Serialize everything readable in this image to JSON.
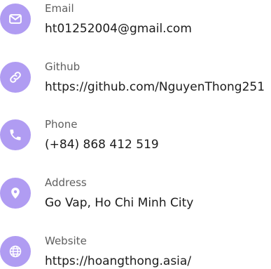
{
  "colors": {
    "icon_background": "#b09cf2",
    "icon_foreground": "#ffffff",
    "label_text": "#5f5f5f",
    "value_text": "#1c1c1c"
  },
  "contacts": [
    {
      "label": "Email",
      "value": "ht01252004@gmail.com",
      "icon": "mail-icon"
    },
    {
      "label": "Github",
      "value": "https://github.com/NguyenThong251",
      "icon": "link-icon"
    },
    {
      "label": "Phone",
      "value": "(+84) 868 412 519",
      "icon": "phone-icon"
    },
    {
      "label": "Address",
      "value": "Go Vap, Ho Chi Minh City",
      "icon": "location-pin-icon"
    },
    {
      "label": "Website",
      "value": "https://hoangthong.asia/",
      "icon": "globe-icon"
    }
  ]
}
